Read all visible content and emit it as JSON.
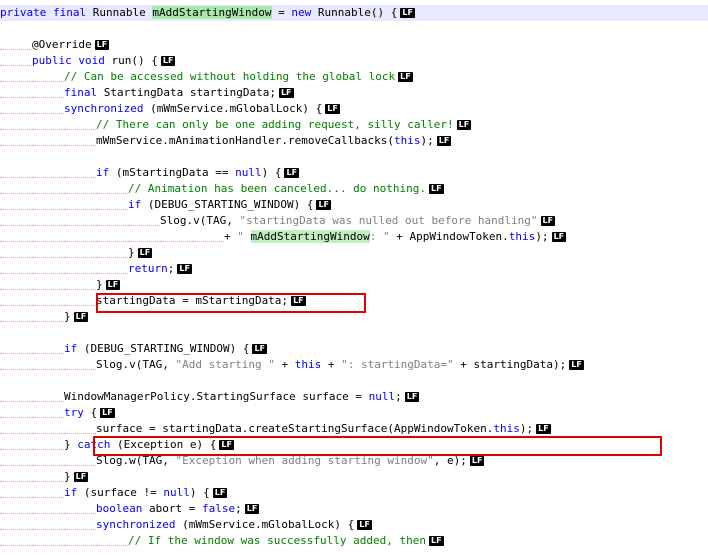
{
  "eol_marker": "LF",
  "colors": {
    "keyword": "#0000ff",
    "comment": "#008000",
    "string": "#808080",
    "highlight": "#a8e8a8",
    "selection_box": "#e00000",
    "line_highlight": "#e8e8ff"
  },
  "lines": [
    {
      "indent": 0,
      "hl": true,
      "lf": true,
      "tokens": [
        [
          "kw",
          "private final "
        ],
        [
          "tx",
          "Runnable "
        ],
        [
          "hl",
          "mAddStartingWindow"
        ],
        [
          "tx",
          " = "
        ],
        [
          "kw",
          "new "
        ],
        [
          "tx",
          "Runnable() {"
        ]
      ]
    },
    {
      "indent": 0,
      "hl": false,
      "lf": false,
      "tokens": []
    },
    {
      "indent": 1,
      "hl": false,
      "lf": true,
      "tokens": [
        [
          "tx",
          "@Override"
        ]
      ]
    },
    {
      "indent": 1,
      "hl": false,
      "lf": true,
      "tokens": [
        [
          "kw",
          "public void "
        ],
        [
          "tx",
          "run() {"
        ]
      ]
    },
    {
      "indent": 2,
      "hl": false,
      "lf": true,
      "tokens": [
        [
          "cm",
          "// Can be accessed without holding the global lock"
        ]
      ]
    },
    {
      "indent": 2,
      "hl": false,
      "lf": true,
      "tokens": [
        [
          "kw",
          "final "
        ],
        [
          "tx",
          "StartingData startingData;"
        ]
      ]
    },
    {
      "indent": 2,
      "hl": false,
      "lf": true,
      "tokens": [
        [
          "kw",
          "synchronized "
        ],
        [
          "tx",
          "(mWmService.mGlobalLock) {"
        ]
      ]
    },
    {
      "indent": 3,
      "hl": false,
      "lf": true,
      "tokens": [
        [
          "cm",
          "// There can only be one adding request, silly caller!"
        ]
      ]
    },
    {
      "indent": 3,
      "hl": false,
      "lf": true,
      "tokens": [
        [
          "tx",
          "mWmService.mAnimationHandler.removeCallbacks("
        ],
        [
          "kw",
          "this"
        ],
        [
          "tx",
          ");"
        ]
      ]
    },
    {
      "indent": 0,
      "hl": false,
      "lf": false,
      "tokens": []
    },
    {
      "indent": 3,
      "hl": false,
      "lf": true,
      "tokens": [
        [
          "kw",
          "if "
        ],
        [
          "tx",
          "(mStartingData == "
        ],
        [
          "kw",
          "null"
        ],
        [
          "tx",
          ") {"
        ]
      ]
    },
    {
      "indent": 4,
      "hl": false,
      "lf": true,
      "tokens": [
        [
          "cm",
          "// Animation has been canceled... do nothing."
        ]
      ]
    },
    {
      "indent": 4,
      "hl": false,
      "lf": true,
      "tokens": [
        [
          "kw",
          "if "
        ],
        [
          "tx",
          "(DEBUG_STARTING_WINDOW) {"
        ]
      ]
    },
    {
      "indent": 5,
      "hl": false,
      "lf": true,
      "tokens": [
        [
          "tx",
          "Slog.v(TAG, "
        ],
        [
          "st",
          "\"startingData was nulled out before handling\""
        ]
      ]
    },
    {
      "indent": 7,
      "hl": false,
      "lf": true,
      "tokens": [
        [
          "tx",
          "+ "
        ],
        [
          "st",
          "\" "
        ],
        [
          "hl2",
          "mAddStartingWindow"
        ],
        [
          "st",
          ": \""
        ],
        [
          "tx",
          " + AppWindowToken."
        ],
        [
          "kw",
          "this"
        ],
        [
          "tx",
          ");"
        ]
      ]
    },
    {
      "indent": 4,
      "hl": false,
      "lf": true,
      "tokens": [
        [
          "tx",
          "}"
        ]
      ]
    },
    {
      "indent": 4,
      "hl": false,
      "lf": true,
      "tokens": [
        [
          "kw",
          "return"
        ],
        [
          "tx",
          ";"
        ]
      ]
    },
    {
      "indent": 3,
      "hl": false,
      "lf": true,
      "tokens": [
        [
          "tx",
          "}"
        ]
      ]
    },
    {
      "indent": 3,
      "hl": false,
      "lf": true,
      "tokens": [
        [
          "tx",
          "startingData = mStartingData;"
        ]
      ]
    },
    {
      "indent": 2,
      "hl": false,
      "lf": true,
      "tokens": [
        [
          "tx",
          "}"
        ]
      ]
    },
    {
      "indent": 0,
      "hl": false,
      "lf": false,
      "tokens": []
    },
    {
      "indent": 2,
      "hl": false,
      "lf": true,
      "tokens": [
        [
          "kw",
          "if "
        ],
        [
          "tx",
          "(DEBUG_STARTING_WINDOW) {"
        ]
      ]
    },
    {
      "indent": 3,
      "hl": false,
      "lf": true,
      "tokens": [
        [
          "tx",
          "Slog.v(TAG, "
        ],
        [
          "st",
          "\"Add starting \""
        ],
        [
          "tx",
          " + "
        ],
        [
          "kw",
          "this"
        ],
        [
          "tx",
          " + "
        ],
        [
          "st",
          "\": startingData=\""
        ],
        [
          "tx",
          " + startingData);"
        ]
      ]
    },
    {
      "indent": 0,
      "hl": false,
      "lf": false,
      "tokens": []
    },
    {
      "indent": 2,
      "hl": false,
      "lf": true,
      "tokens": [
        [
          "tx",
          "WindowManagerPolicy.StartingSurface surface = "
        ],
        [
          "kw",
          "null"
        ],
        [
          "tx",
          ";"
        ]
      ]
    },
    {
      "indent": 2,
      "hl": false,
      "lf": true,
      "tokens": [
        [
          "kw",
          "try "
        ],
        [
          "tx",
          "{"
        ]
      ]
    },
    {
      "indent": 3,
      "hl": false,
      "lf": true,
      "tokens": [
        [
          "tx",
          "surface = startingData.createStartingSurface(AppWindowToken."
        ],
        [
          "kw",
          "this"
        ],
        [
          "tx",
          ");"
        ]
      ]
    },
    {
      "indent": 2,
      "hl": false,
      "lf": true,
      "tokens": [
        [
          "tx",
          "} "
        ],
        [
          "kw",
          "catch "
        ],
        [
          "tx",
          "(Exception e) {"
        ]
      ]
    },
    {
      "indent": 3,
      "hl": false,
      "lf": true,
      "tokens": [
        [
          "tx",
          "Slog.w(TAG, "
        ],
        [
          "st",
          "\"Exception when adding starting window\""
        ],
        [
          "tx",
          ", e);"
        ]
      ]
    },
    {
      "indent": 2,
      "hl": false,
      "lf": true,
      "tokens": [
        [
          "tx",
          "}"
        ]
      ]
    },
    {
      "indent": 2,
      "hl": false,
      "lf": true,
      "tokens": [
        [
          "kw",
          "if "
        ],
        [
          "tx",
          "(surface != "
        ],
        [
          "kw",
          "null"
        ],
        [
          "tx",
          ") {"
        ]
      ]
    },
    {
      "indent": 3,
      "hl": false,
      "lf": true,
      "tokens": [
        [
          "kw",
          "boolean "
        ],
        [
          "tx",
          "abort = "
        ],
        [
          "kw",
          "false"
        ],
        [
          "tx",
          ";"
        ]
      ]
    },
    {
      "indent": 3,
      "hl": false,
      "lf": true,
      "tokens": [
        [
          "kw",
          "synchronized "
        ],
        [
          "tx",
          "(mWmService.mGlobalLock) {"
        ]
      ]
    },
    {
      "indent": 4,
      "hl": false,
      "lf": true,
      "tokens": [
        [
          "cm",
          "// If the window was successfully added, then"
        ]
      ]
    }
  ]
}
